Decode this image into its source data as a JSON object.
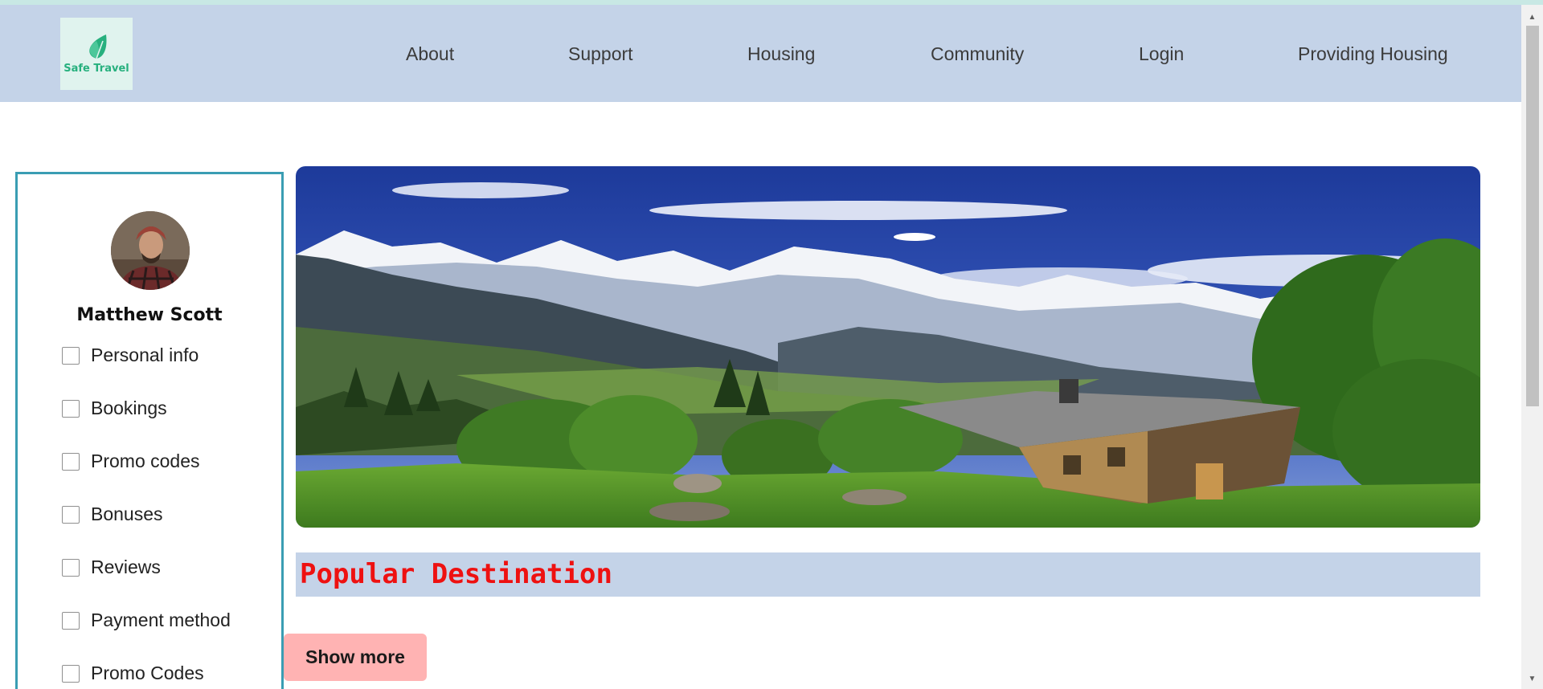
{
  "brand": {
    "name": "Safe Travel"
  },
  "nav": {
    "items": [
      {
        "label": "About"
      },
      {
        "label": "Support"
      },
      {
        "label": "Housing"
      },
      {
        "label": "Community"
      },
      {
        "label": "Login"
      },
      {
        "label": "Providing Housing"
      }
    ]
  },
  "sidebar": {
    "user_name": "Matthew Scott",
    "menu": [
      {
        "label": "Personal info",
        "checked": false
      },
      {
        "label": "Bookings",
        "checked": false
      },
      {
        "label": "Promo codes",
        "checked": false
      },
      {
        "label": "Bonuses",
        "checked": false
      },
      {
        "label": "Reviews",
        "checked": false
      },
      {
        "label": "Payment method",
        "checked": false
      },
      {
        "label": "Promo Codes",
        "checked": false
      }
    ]
  },
  "main": {
    "section_title": "Popular Destination",
    "show_more_label": "Show more"
  },
  "colors": {
    "header_bg": "#c4d3e8",
    "sidebar_border": "#3a9db3",
    "section_title": "#ee1111",
    "button_bg": "#ffb3b3",
    "brand_green": "#27b07e"
  },
  "icons": {
    "logo": "leaf-icon",
    "scroll_up": "triangle-up-icon",
    "scroll_down": "triangle-down-icon"
  }
}
